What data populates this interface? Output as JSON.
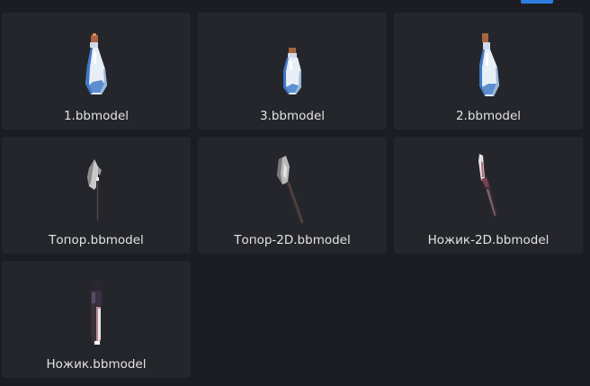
{
  "models": [
    {
      "filename": "1.bbmodel",
      "icon": "potion-bottle-icon"
    },
    {
      "filename": "3.bbmodel",
      "icon": "potion-bottle-icon"
    },
    {
      "filename": "2.bbmodel",
      "icon": "potion-bottle-icon"
    },
    {
      "filename": "Топор.bbmodel",
      "icon": "axe-icon"
    },
    {
      "filename": "Топор-2D.bbmodel",
      "icon": "axe-icon"
    },
    {
      "filename": "Ножик-2D.bbmodel",
      "icon": "knife-icon"
    },
    {
      "filename": "Ножик.bbmodel",
      "icon": "knife-icon"
    }
  ],
  "colors": {
    "background": "#1b1d22",
    "card": "#24262c",
    "accent": "#2f7de0",
    "label": "#e3e3e3"
  }
}
